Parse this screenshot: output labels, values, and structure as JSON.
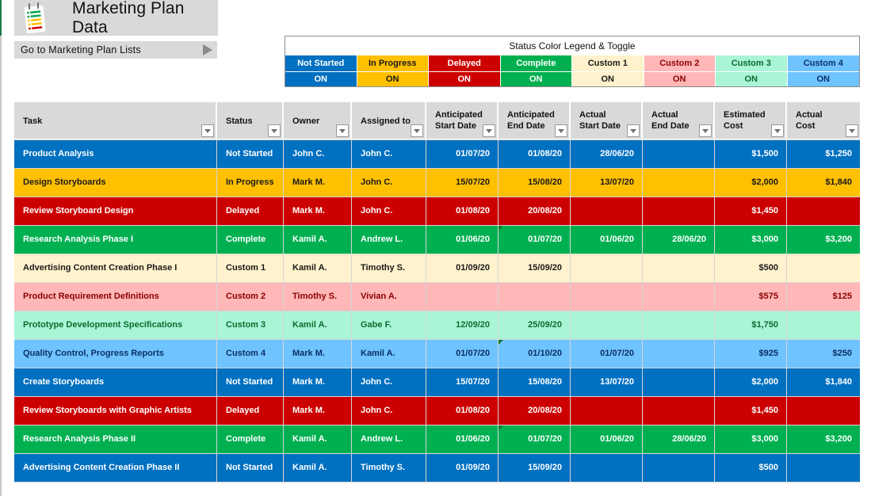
{
  "header": {
    "title": "Marketing Plan Data",
    "nav_button_label": "Go to Marketing Plan Lists"
  },
  "legend": {
    "title": "Status Color Legend & Toggle",
    "items": [
      {
        "label": "Not Started",
        "toggle": "ON",
        "bg": "#0070c0",
        "fg": "#ffffff"
      },
      {
        "label": "In Progress",
        "toggle": "ON",
        "bg": "#ffc000",
        "fg": "#1a1a1a"
      },
      {
        "label": "Delayed",
        "toggle": "ON",
        "bg": "#cc0000",
        "fg": "#ffffff"
      },
      {
        "label": "Complete",
        "toggle": "ON",
        "bg": "#00b050",
        "fg": "#ffffff"
      },
      {
        "label": "Custom 1",
        "toggle": "ON",
        "bg": "#fff2cc",
        "fg": "#1a1a1a"
      },
      {
        "label": "Custom 2",
        "toggle": "ON",
        "bg": "#ffb7b7",
        "fg": "#8b0000"
      },
      {
        "label": "Custom 3",
        "toggle": "ON",
        "bg": "#a9f5d6",
        "fg": "#0b6b2e"
      },
      {
        "label": "Custom 4",
        "toggle": "ON",
        "bg": "#6fc3ff",
        "fg": "#0b2f66"
      }
    ]
  },
  "table": {
    "columns": [
      {
        "label": "Task",
        "align": "l"
      },
      {
        "label": "Status",
        "align": "l"
      },
      {
        "label": "Owner",
        "align": "l"
      },
      {
        "label": "Assigned to",
        "align": "l"
      },
      {
        "label": "Anticipated\nStart Date",
        "align": "r"
      },
      {
        "label": "Anticipated\nEnd Date",
        "align": "r"
      },
      {
        "label": "Actual\nStart Date",
        "align": "r"
      },
      {
        "label": "Actual\nEnd Date",
        "align": "r"
      },
      {
        "label": "Estimated\nCost",
        "align": "r"
      },
      {
        "label": "Actual\nCost",
        "align": "r"
      }
    ],
    "rows": [
      {
        "task": "Product Analysis",
        "status": "Not Started",
        "owner": "John C.",
        "assigned": "John C.",
        "ant_start": "01/07/20",
        "ant_end": "01/08/20",
        "act_start": "28/06/20",
        "act_end": "",
        "est_cost": "$1,500",
        "act_cost": "$1,250",
        "note_on_ant_end": false
      },
      {
        "task": "Design Storyboards",
        "status": "In Progress",
        "owner": "Mark M.",
        "assigned": "John C.",
        "ant_start": "15/07/20",
        "ant_end": "15/08/20",
        "act_start": "13/07/20",
        "act_end": "",
        "est_cost": "$2,000",
        "act_cost": "$1,840",
        "note_on_ant_end": false
      },
      {
        "task": "Review Storyboard Design",
        "status": "Delayed",
        "owner": "Mark M.",
        "assigned": "John C.",
        "ant_start": "01/08/20",
        "ant_end": "20/08/20",
        "act_start": "",
        "act_end": "",
        "est_cost": "$1,450",
        "act_cost": "",
        "note_on_ant_end": false
      },
      {
        "task": "Research Analysis Phase I",
        "status": "Complete",
        "owner": "Kamil A.",
        "assigned": "Andrew L.",
        "ant_start": "01/06/20",
        "ant_end": "01/07/20",
        "act_start": "01/06/20",
        "act_end": "28/06/20",
        "est_cost": "$3,000",
        "act_cost": "$3,200",
        "note_on_ant_end": true
      },
      {
        "task": "Advertising Content Creation Phase I",
        "status": "Custom 1",
        "owner": "Kamil A.",
        "assigned": "Timothy S.",
        "ant_start": "01/09/20",
        "ant_end": "15/09/20",
        "act_start": "",
        "act_end": "",
        "est_cost": "$500",
        "act_cost": "",
        "note_on_ant_end": false
      },
      {
        "task": "Product Requirement Definitions",
        "status": "Custom 2",
        "owner": "Timothy S.",
        "assigned": "Vivian A.",
        "ant_start": "",
        "ant_end": "",
        "act_start": "",
        "act_end": "",
        "est_cost": "$575",
        "act_cost": "$125",
        "note_on_ant_end": false
      },
      {
        "task": "Prototype Development Specifications",
        "status": "Custom 3",
        "owner": "Kamil A.",
        "assigned": "Gabe F.",
        "ant_start": "12/09/20",
        "ant_end": "25/09/20",
        "act_start": "",
        "act_end": "",
        "est_cost": "$1,750",
        "act_cost": "",
        "note_on_ant_end": false
      },
      {
        "task": "Quality Control, Progress Reports",
        "status": "Custom 4",
        "owner": "Mark M.",
        "assigned": "Kamil A.",
        "ant_start": "01/07/20",
        "ant_end": "01/10/20",
        "act_start": "01/07/20",
        "act_end": "",
        "est_cost": "$925",
        "act_cost": "$250",
        "note_on_ant_end": true
      },
      {
        "task": "Create Storyboards",
        "status": "Not Started",
        "owner": "Mark M.",
        "assigned": "John C.",
        "ant_start": "15/07/20",
        "ant_end": "15/08/20",
        "act_start": "13/07/20",
        "act_end": "",
        "est_cost": "$2,000",
        "act_cost": "$1,840",
        "note_on_ant_end": false
      },
      {
        "task": "Review Storyboards with Graphic Artists",
        "status": "Delayed",
        "owner": "Mark M.",
        "assigned": "John C.",
        "ant_start": "01/08/20",
        "ant_end": "20/08/20",
        "act_start": "",
        "act_end": "",
        "est_cost": "$1,450",
        "act_cost": "",
        "note_on_ant_end": false
      },
      {
        "task": "Research Analysis Phase II",
        "status": "Complete",
        "owner": "Kamil A.",
        "assigned": "Andrew L.",
        "ant_start": "01/06/20",
        "ant_end": "01/07/20",
        "act_start": "01/06/20",
        "act_end": "28/06/20",
        "est_cost": "$3,000",
        "act_cost": "$3,200",
        "note_on_ant_end": true
      },
      {
        "task": "Advertising Content Creation Phase II",
        "status": "Not Started",
        "owner": "Kamil A.",
        "assigned": "Timothy S.",
        "ant_start": "01/09/20",
        "ant_end": "15/09/20",
        "act_start": "",
        "act_end": "",
        "est_cost": "$500",
        "act_cost": "",
        "note_on_ant_end": false
      }
    ]
  }
}
